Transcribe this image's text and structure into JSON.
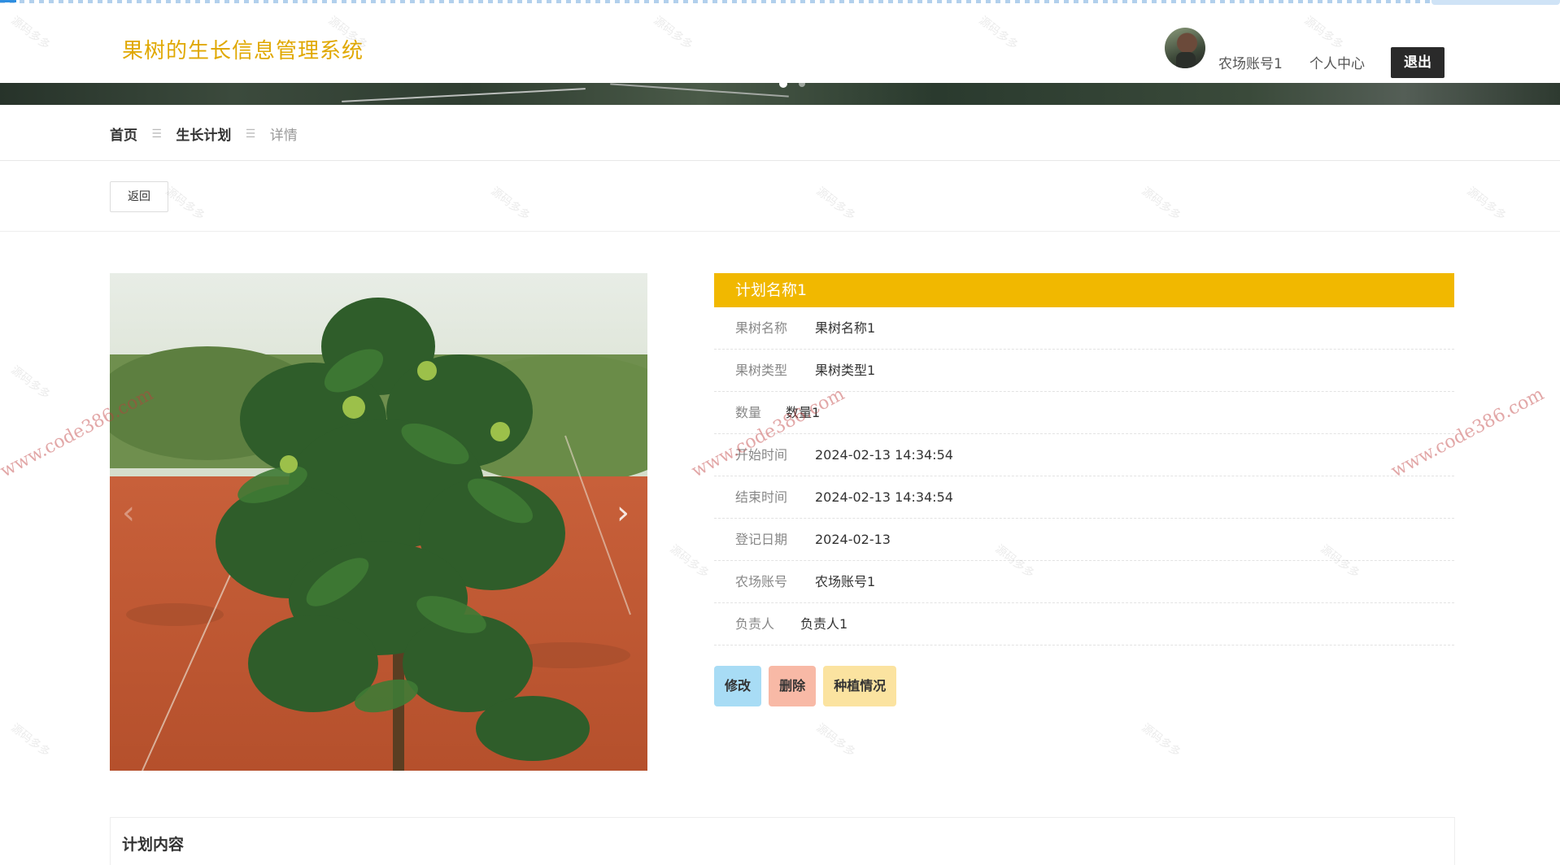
{
  "header": {
    "site_title": "果树的生长信息管理系统",
    "user_name": "农场账号1",
    "center_link": "个人中心",
    "logout_label": "退出"
  },
  "breadcrumb": {
    "home": "首页",
    "section": "生长计划",
    "current": "详情",
    "separator": "☰"
  },
  "back_label": "返回",
  "detail": {
    "title": "计划名称1",
    "fields": [
      {
        "label": "果树名称",
        "value": "果树名称1"
      },
      {
        "label": "果树类型",
        "value": "果树类型1"
      },
      {
        "label": "数量",
        "value": "数量1"
      },
      {
        "label": "开始时间",
        "value": "2024-02-13 14:34:54"
      },
      {
        "label": "结束时间",
        "value": "2024-02-13 14:34:54"
      },
      {
        "label": "登记日期",
        "value": "2024-02-13"
      },
      {
        "label": "农场账号",
        "value": "农场账号1"
      },
      {
        "label": "负责人",
        "value": "负责人1"
      }
    ],
    "actions": {
      "edit": "修改",
      "delete": "删除",
      "planting": "种植情况"
    }
  },
  "carousel": {
    "prev_icon": "‹",
    "next_icon": "›"
  },
  "content_section_title": "计划内容",
  "watermark": {
    "url_text": "www.code386.com",
    "tile_text": "源码多多"
  },
  "colors": {
    "brand": "#e0a800",
    "title_bar": "#f1b800",
    "edit": "#a8dcf5",
    "delete": "#f8b9a6",
    "planting": "#fbe3a0"
  }
}
